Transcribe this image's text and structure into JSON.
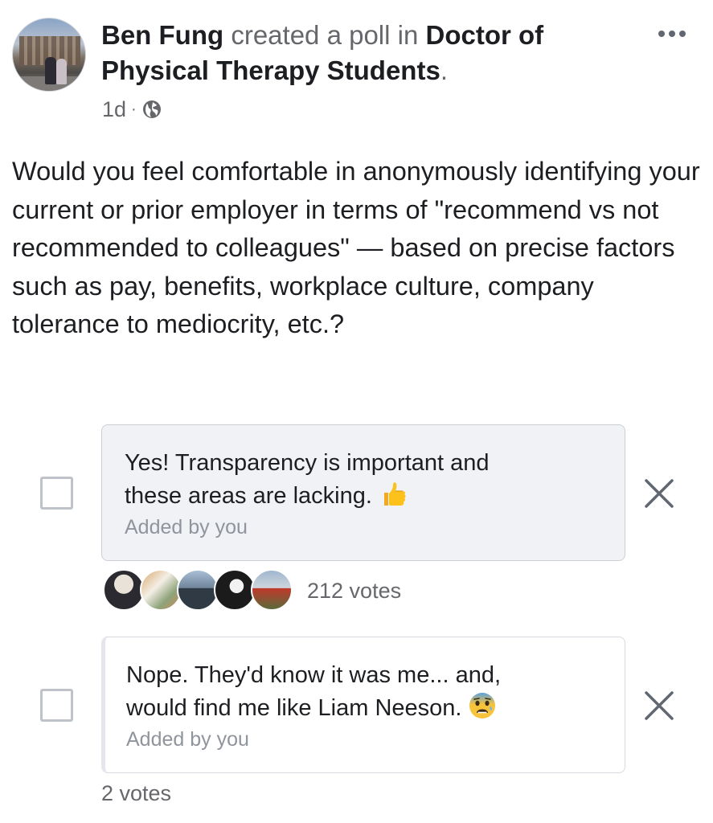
{
  "post": {
    "author": "Ben Fung",
    "action": "created a poll in",
    "group_line1": "Doctor of",
    "group_line2": "Physical Therapy Students",
    "period": ".",
    "time": "1d",
    "separator": "·",
    "privacy_icon": "globe-icon",
    "more_icon": "more-options-icon",
    "question": "Would you feel comfortable in anonymously identifying your current or prior employer in terms of \"recommend vs not recommended to colleagues\" — based on precise factors such as pay, benefits, workplace culture, company tolerance to mediocrity, etc.?"
  },
  "poll": {
    "options": [
      {
        "line1": "Yes! Transparency is important and",
        "line2": "these areas are lacking.",
        "emoji": "thumbs-up-emoji",
        "added_by": "Added by you",
        "votes": "212 votes"
      },
      {
        "line1": "Nope. They'd know it was me... and,",
        "line2": "would find me like Liam Neeson.",
        "emoji": "anxious-face-emoji",
        "added_by": "Added by you",
        "votes": "2 votes"
      }
    ]
  },
  "colors": {
    "text": "#1c1e21",
    "secondary": "#65676b",
    "option_bg": "#f0f2f5",
    "border": "#ccd0d5"
  }
}
